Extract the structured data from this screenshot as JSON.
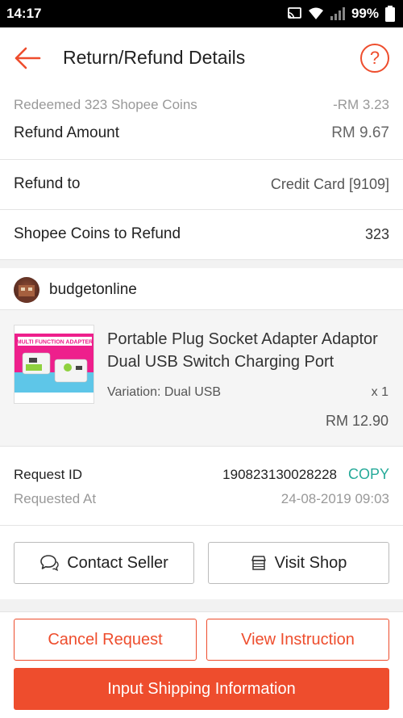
{
  "status_bar": {
    "time": "14:17",
    "battery": "99%"
  },
  "header": {
    "title": "Return/Refund Details",
    "help": "?"
  },
  "summary": {
    "coins_label": "Redeemed 323 Shopee Coins",
    "coins_value": "-RM 3.23",
    "refund_label": "Refund Amount",
    "refund_value": "RM 9.67"
  },
  "refund_to": {
    "label": "Refund to",
    "value": "Credit Card [9109]"
  },
  "coins_refund": {
    "label": "Shopee Coins to Refund",
    "value": "323"
  },
  "shop": {
    "name": "budgetonline"
  },
  "product": {
    "title": "Portable Plug Socket Adapter Adaptor Dual USB Switch Charging Port",
    "variation": "Variation: Dual USB",
    "quantity": "x 1",
    "price": "RM 12.90",
    "thumb_text": "MULTI FUNCTION ADAPTER"
  },
  "request": {
    "id_label": "Request ID",
    "id_value": "190823130028228",
    "copy_label": "COPY",
    "time_label": "Requested At",
    "time_value": "24-08-2019 09:03"
  },
  "actions": {
    "contact_seller": "Contact Seller",
    "visit_shop": "Visit Shop",
    "cancel_request": "Cancel Request",
    "view_instruction": "View Instruction",
    "input_shipping": "Input Shipping Information"
  },
  "colors": {
    "brand": "#ee4d2d",
    "copy": "#26aa99"
  }
}
